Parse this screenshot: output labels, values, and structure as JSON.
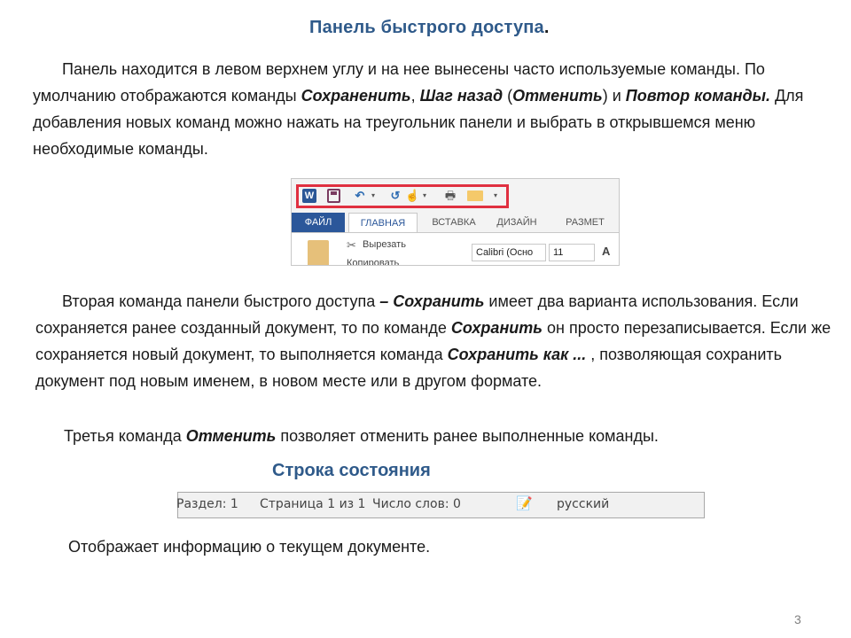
{
  "title": "Панель быстрого доступа",
  "title_end": ".",
  "paragraph1": {
    "t1": "Панель находится в левом верхнем углу и на нее вынесены часто используемые команды. По умолчанию отображаются команды ",
    "b1": "Сохраненить",
    "t2": ", ",
    "b2": "Шаг назад",
    "t3": " (",
    "b3": "Отменить",
    "t4": ") и ",
    "b4": "Повтор команды.",
    "t5": " Для добавления новых команд можно нажать на треугольник панели и выбрать в открывшемся меню необходимые команды."
  },
  "ribbon": {
    "icons": [
      "word-logo-icon",
      "save-icon",
      "undo-icon",
      "dropdown-arrow-icon",
      "redo-icon",
      "touch-mode-icon",
      "dropdown-arrow-icon",
      "print-preview-icon",
      "open-folder-icon",
      "customize-qat-icon"
    ],
    "word_glyph": "W",
    "undo_glyph": "↶",
    "redo_glyph": "↺",
    "touch_glyph": "☝",
    "print_glyph": "🖶",
    "arrow_glyph": "▾",
    "highlight_color": "#e03040",
    "tabs": [
      "ФАЙЛ",
      "ГЛАВНАЯ",
      "ВСТАВКА",
      "ДИЗАЙН",
      "РАЗМЕТ"
    ],
    "cut_glyph": "✂",
    "cut_label": "Вырезать",
    "copy_label": "Копировать",
    "font_name": "Calibri (Осно",
    "font_size": "11",
    "grow_label": "A"
  },
  "paragraph2": {
    "t1": "Вторая команда панели быстрого доступа ",
    "b1": "– Сохранить",
    "t2": " имеет два варианта использования. Если сохраняется ранее созданный документ, то по команде ",
    "b2": "Сохранить",
    "t3": " он просто перезаписывается. Если же сохраняется новый документ, то выполняется команда ",
    "b3": "Сохранить как ...",
    "t4": " , позволяющая сохранить документ под новым именем, в новом месте или в другом формате."
  },
  "paragraph3": {
    "t1": "Третья команда ",
    "b1": "Отменить",
    "t2": " позволяет отменить ранее выполненные команды."
  },
  "status_title": "Строка состояния",
  "statusbar": {
    "section": "Раздел: 1",
    "page": "Страница 1 из 1",
    "words": "Число слов: 0",
    "proofing_icon": "📝",
    "language": "русский"
  },
  "paragraph4": "Отображает информацию о текущем документе.",
  "page_number": "3"
}
